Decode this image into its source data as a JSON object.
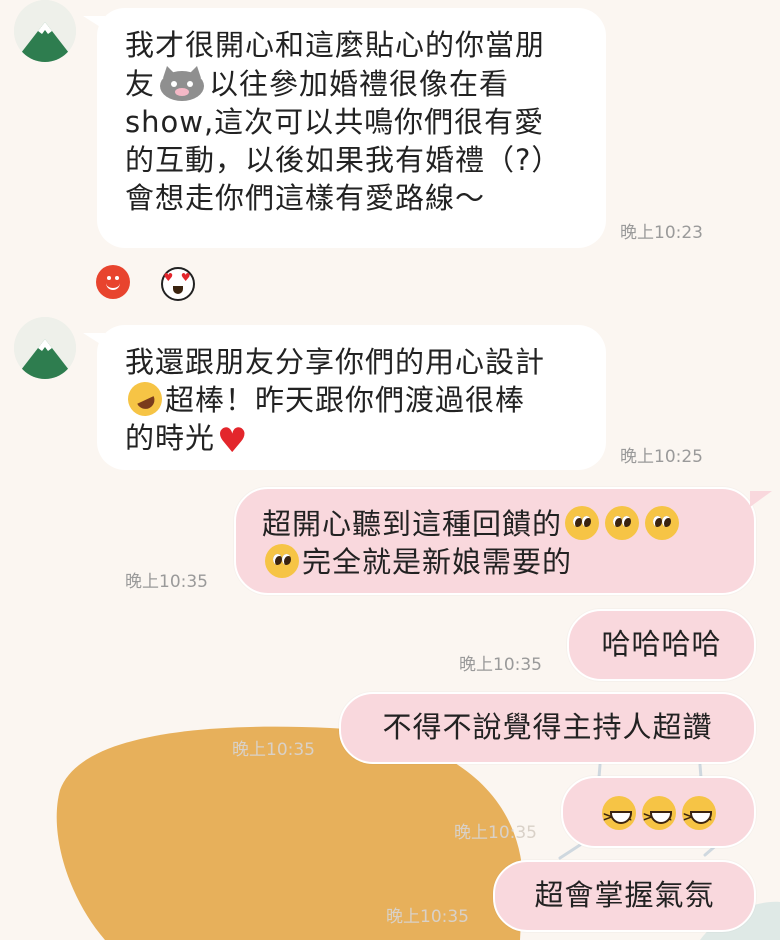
{
  "messages_in": [
    {
      "lines": [
        "我才很開心和這麼貼心的你當朋",
        "以往參加婚禮很像在看",
        "show,這次可以共鳴你們很有愛",
        "的互動，以後如果我有婚禮（?）",
        "會想走你們這樣有愛路線～"
      ],
      "line2_prefix": "友",
      "time": "晚上10:23"
    },
    {
      "line1": "我還跟朋友分享你們的用心設計",
      "line2": "超棒！昨天跟你們渡過很棒",
      "line3": "的時光",
      "time": "晚上10:25"
    }
  ],
  "messages_out": [
    {
      "text_a": "超開心聽到這種回饋的",
      "text_b": "完全就是新娘需要的",
      "time": "晚上10:35"
    },
    {
      "text": "哈哈哈哈",
      "time": "晚上10:35"
    },
    {
      "text": "不得不說覺得主持人超讚",
      "time": "晚上10:35"
    },
    {
      "text": "",
      "time": "晚上10:35"
    },
    {
      "text": "超會掌握氣氛",
      "time": "晚上10:35"
    }
  ],
  "icons": {
    "avatar": "mountain-avatar-icon",
    "reaction_1": "smile-reaction-icon",
    "reaction_2": "heart-eyes-reaction-icon"
  },
  "colors": {
    "background": "#fbf6f1",
    "incoming_bubble": "#ffffff",
    "outgoing_bubble": "#f9d8dd",
    "deco_blob": "#e7b05b",
    "timestamp": "#9a9a9a"
  }
}
